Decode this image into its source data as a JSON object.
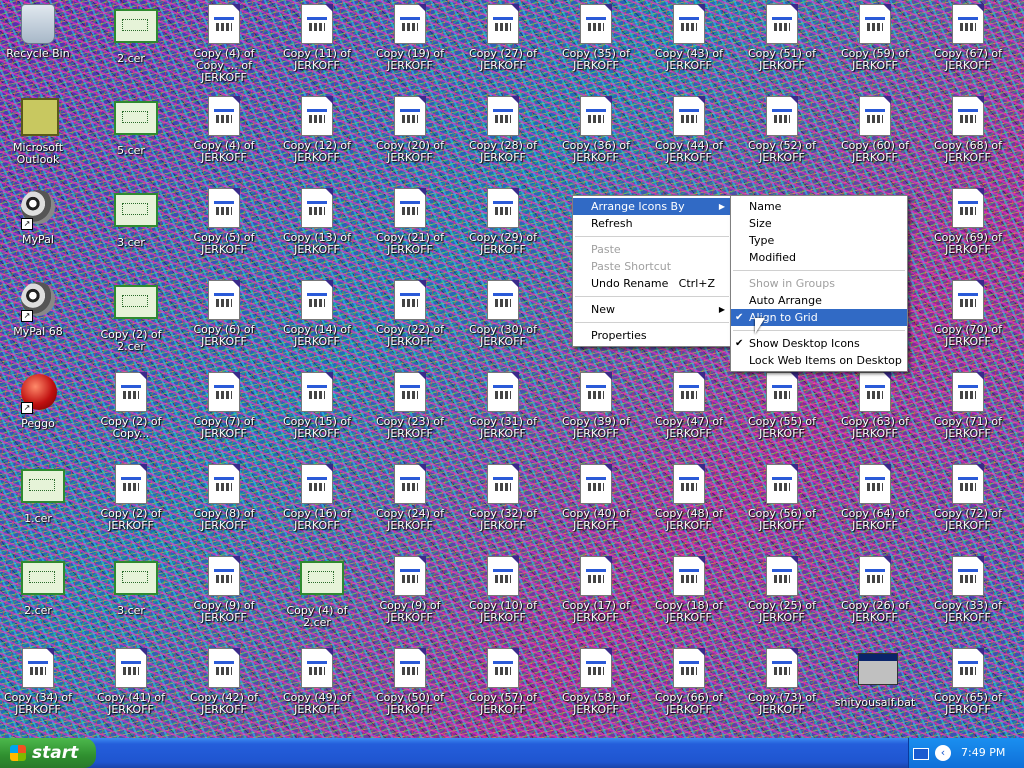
{
  "desktop": {
    "icons": [
      {
        "label": "Recycle Bin",
        "type": "recycle",
        "interactive": true
      },
      {
        "label": "Microsoft Outlook",
        "type": "outlook"
      },
      {
        "label": "MyPal",
        "type": "raccoon",
        "shortcut": true
      },
      {
        "label": "MyPal 68",
        "type": "raccoon",
        "shortcut": true
      },
      {
        "label": "Peggo",
        "type": "peggo",
        "shortcut": true
      },
      {
        "label": "1.cer",
        "type": "cert"
      },
      {
        "label": "2.cer",
        "type": "cert"
      },
      {
        "label": "Copy (34) of JERKOFF",
        "type": "doc"
      },
      {
        "label": "2.cer",
        "type": "cert"
      },
      {
        "label": "5.cer",
        "type": "cert"
      },
      {
        "label": "3.cer",
        "type": "cert"
      },
      {
        "label": "Copy (2) of 2.cer",
        "type": "cert"
      },
      {
        "label": "Copy (2) of Copy...",
        "type": "doc"
      },
      {
        "label": "Copy (2) of JERKOFF",
        "type": "doc"
      },
      {
        "label": "3.cer",
        "type": "cert"
      },
      {
        "label": "Copy (41) of JERKOFF",
        "type": "doc"
      },
      {
        "label": "Copy (4) of Copy ... of JERKOFF",
        "type": "doc"
      },
      {
        "label": "Copy (4) of JERKOFF",
        "type": "doc"
      },
      {
        "label": "Copy (5) of JERKOFF",
        "type": "doc"
      },
      {
        "label": "Copy (6) of JERKOFF",
        "type": "doc"
      },
      {
        "label": "Copy (7) of JERKOFF",
        "type": "doc"
      },
      {
        "label": "Copy (8) of JERKOFF",
        "type": "doc"
      },
      {
        "label": "Copy (9) of JERKOFF",
        "type": "doc"
      },
      {
        "label": "Copy (42) of JERKOFF",
        "type": "doc"
      },
      {
        "label": "Copy (11) of JERKOFF",
        "type": "doc"
      },
      {
        "label": "Copy (12) of JERKOFF",
        "type": "doc"
      },
      {
        "label": "Copy (13) of JERKOFF",
        "type": "doc"
      },
      {
        "label": "Copy (14) of JERKOFF",
        "type": "doc"
      },
      {
        "label": "Copy (15) of JERKOFF",
        "type": "doc"
      },
      {
        "label": "Copy (16) of JERKOFF",
        "type": "doc"
      },
      {
        "label": "Copy (4) of 2.cer",
        "type": "cert"
      },
      {
        "label": "Copy (49) of JERKOFF",
        "type": "doc"
      },
      {
        "label": "Copy (19) of JERKOFF",
        "type": "doc"
      },
      {
        "label": "Copy (20) of JERKOFF",
        "type": "doc"
      },
      {
        "label": "Copy (21) of JERKOFF",
        "type": "doc"
      },
      {
        "label": "Copy (22) of JERKOFF",
        "type": "doc"
      },
      {
        "label": "Copy (23) of JERKOFF",
        "type": "doc"
      },
      {
        "label": "Copy (24) of JERKOFF",
        "type": "doc"
      },
      {
        "label": "Copy (9) of JERKOFF",
        "type": "doc"
      },
      {
        "label": "Copy (50) of JERKOFF",
        "type": "doc"
      },
      {
        "label": "Copy (27) of JERKOFF",
        "type": "doc"
      },
      {
        "label": "Copy (28) of JERKOFF",
        "type": "doc"
      },
      {
        "label": "Copy (29) of JERKOFF",
        "type": "doc"
      },
      {
        "label": "Copy (30) of JERKOFF",
        "type": "doc"
      },
      {
        "label": "Copy (31) of JERKOFF",
        "type": "doc"
      },
      {
        "label": "Copy (32) of JERKOFF",
        "type": "doc"
      },
      {
        "label": "Copy (10) of JERKOFF",
        "type": "doc"
      },
      {
        "label": "Copy (57) of JERKOFF",
        "type": "doc"
      },
      {
        "label": "Copy (35) of JERKOFF",
        "type": "doc"
      },
      {
        "label": "Copy (36) of JERKOFF",
        "type": "doc"
      },
      {
        "label": "",
        "type": "hidden"
      },
      {
        "label": "",
        "type": "hidden"
      },
      {
        "label": "Copy (39) of JERKOFF",
        "type": "doc"
      },
      {
        "label": "Copy (40) of JERKOFF",
        "type": "doc"
      },
      {
        "label": "Copy (17) of JERKOFF",
        "type": "doc"
      },
      {
        "label": "Copy (58) of JERKOFF",
        "type": "doc"
      },
      {
        "label": "Copy (43) of JERKOFF",
        "type": "doc"
      },
      {
        "label": "Copy (44) of JERKOFF",
        "type": "doc"
      },
      {
        "label": "",
        "type": "hidden"
      },
      {
        "label": "",
        "type": "hidden"
      },
      {
        "label": "Copy (47) of JERKOFF",
        "type": "doc"
      },
      {
        "label": "Copy (48) of JERKOFF",
        "type": "doc"
      },
      {
        "label": "Copy (18) of JERKOFF",
        "type": "doc"
      },
      {
        "label": "Copy (66) of JERKOFF",
        "type": "doc"
      },
      {
        "label": "Copy (51) of JERKOFF",
        "type": "doc"
      },
      {
        "label": "Copy (52) of JERKOFF",
        "type": "doc"
      },
      {
        "label": "",
        "type": "hidden"
      },
      {
        "label": "",
        "type": "hidden"
      },
      {
        "label": "Copy (55) of JERKOFF",
        "type": "doc"
      },
      {
        "label": "Copy (56) of JERKOFF",
        "type": "doc"
      },
      {
        "label": "Copy (25) of JERKOFF",
        "type": "doc"
      },
      {
        "label": "Copy (73) of JERKOFF",
        "type": "doc"
      },
      {
        "label": "Copy (59) of JERKOFF",
        "type": "doc"
      },
      {
        "label": "Copy (60) of JERKOFF",
        "type": "doc"
      },
      {
        "label": "",
        "type": "hidden"
      },
      {
        "label": "",
        "type": "hidden"
      },
      {
        "label": "Copy (63) of JERKOFF",
        "type": "doc"
      },
      {
        "label": "Copy (64) of JERKOFF",
        "type": "doc"
      },
      {
        "label": "Copy (26) of JERKOFF",
        "type": "doc"
      },
      {
        "label": "shityousalf.bat",
        "type": "bat"
      },
      {
        "label": "Copy (67) of JERKOFF",
        "type": "doc"
      },
      {
        "label": "Copy (68) of JERKOFF",
        "type": "doc"
      },
      {
        "label": "Copy (69) of JERKOFF",
        "type": "doc"
      },
      {
        "label": "Copy (70) of JERKOFF",
        "type": "doc"
      },
      {
        "label": "Copy (71) of JERKOFF",
        "type": "doc"
      },
      {
        "label": "Copy (72) of JERKOFF",
        "type": "doc"
      },
      {
        "label": "Copy (33) of JERKOFF",
        "type": "doc"
      },
      {
        "label": "Copy (65) of JERKOFF",
        "type": "doc"
      }
    ]
  },
  "context_menu": {
    "items": [
      {
        "label": "Arrange Icons By",
        "highlighted": true,
        "submenu": true
      },
      {
        "label": "Refresh"
      },
      {
        "sep": true
      },
      {
        "label": "Paste",
        "disabled": true
      },
      {
        "label": "Paste Shortcut",
        "disabled": true
      },
      {
        "label": "Undo Rename",
        "shortcut": "Ctrl+Z"
      },
      {
        "sep": true
      },
      {
        "label": "New",
        "submenu": true
      },
      {
        "sep": true
      },
      {
        "label": "Properties"
      }
    ]
  },
  "submenu": {
    "items": [
      {
        "label": "Name"
      },
      {
        "label": "Size"
      },
      {
        "label": "Type"
      },
      {
        "label": "Modified"
      },
      {
        "sep": true
      },
      {
        "label": "Show in Groups",
        "disabled": true
      },
      {
        "label": "Auto Arrange"
      },
      {
        "label": "Align to Grid",
        "checked": true,
        "highlighted": true
      },
      {
        "sep": true
      },
      {
        "label": "Show Desktop Icons",
        "checked": true
      },
      {
        "label": "Lock Web Items on Desktop"
      }
    ]
  },
  "taskbar": {
    "start_label": "start",
    "clock": "7:49 PM"
  },
  "colors": {
    "highlight": "#316ac5",
    "taskbar": "#245edb",
    "start": "#2f8f2f"
  }
}
